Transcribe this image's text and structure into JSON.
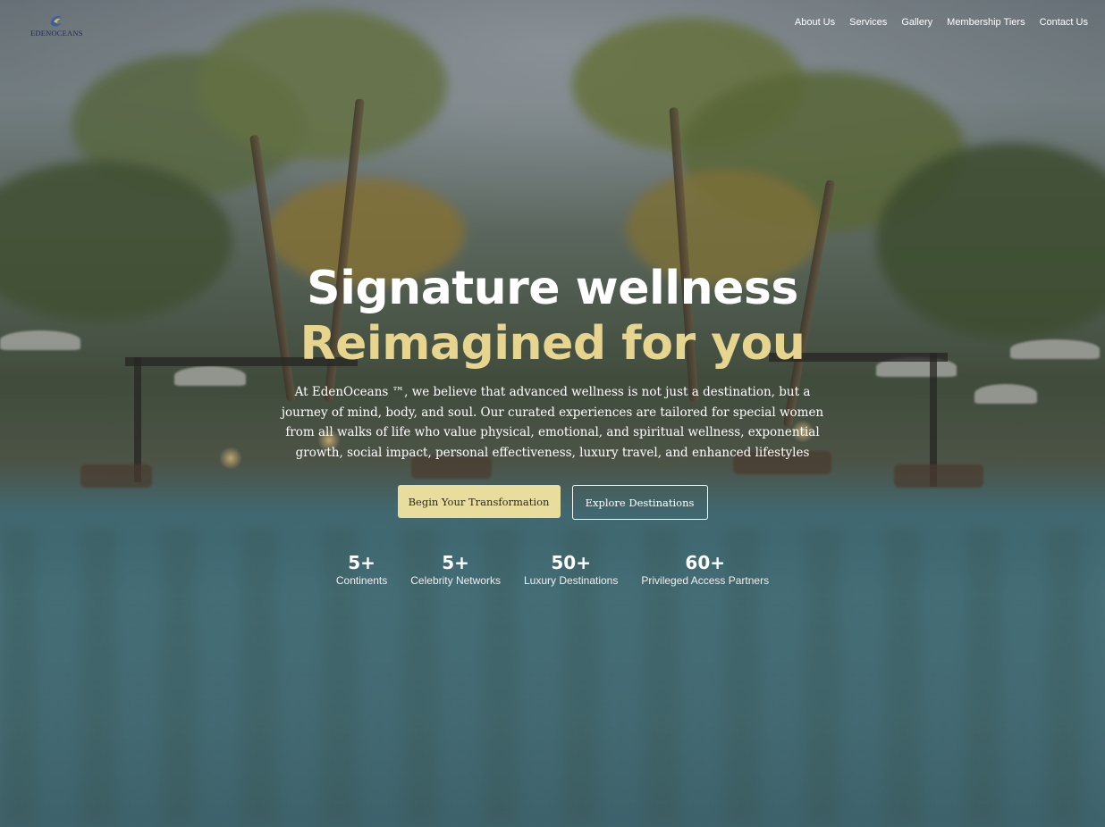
{
  "header": {
    "logo_text": "EDENOCEANS",
    "nav": [
      {
        "label": "About Us"
      },
      {
        "label": "Services"
      },
      {
        "label": "Gallery"
      },
      {
        "label": "Membership Tiers"
      },
      {
        "label": "Contact Us"
      }
    ]
  },
  "hero": {
    "headline": "Signature wellness",
    "headline_accent": "Reimagined for you",
    "intro": "At EdenOceans ™, we believe that advanced wellness is not just a destination, but a journey of mind, body, and soul. Our curated experiences are tailored for special women from all walks of life who value physical, emotional, and spiritual wellness, exponential growth, social impact, personal effectiveness, luxury travel, and enhanced lifestyles",
    "primary_cta": "Begin Your Transformation",
    "secondary_cta": "Explore Destinations"
  },
  "stats": [
    {
      "value": "5+",
      "label": "Continents"
    },
    {
      "value": "5+",
      "label": "Celebrity Networks"
    },
    {
      "value": "50+",
      "label": "Luxury Destinations"
    },
    {
      "value": "60+",
      "label": "Privileged Access Partners"
    }
  ],
  "colors": {
    "accent_gold": "#e6d48f",
    "button_gold": "#e8dd9c",
    "logo_navy": "#1f2a4a"
  }
}
